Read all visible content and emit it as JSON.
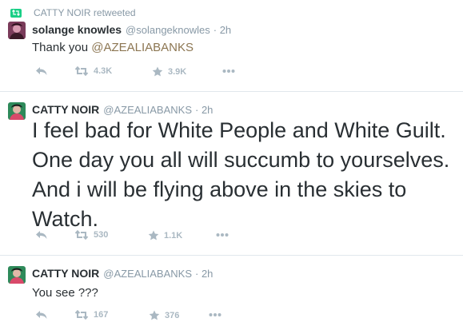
{
  "tweets": [
    {
      "retweeted_by": "CATTY NOIR retweeted",
      "name": "solange knowles",
      "handle": "@solangeknowles",
      "time": "· 2h",
      "text_prefix": "Thank you ",
      "mention": "@AZEALIABANKS",
      "retweets": "4.3K",
      "favorites": "3.9K"
    },
    {
      "name": "CATTY NOIR",
      "handle": "@AZEALIABANKS",
      "time": "· 2h",
      "lines": [
        "I feel bad for White People and White Guilt.",
        "One day you all will succumb to yourselves.",
        "And i will be flying above in the skies to",
        "Watch."
      ],
      "retweets": "530",
      "favorites": "1.1K"
    },
    {
      "name": "CATTY NOIR",
      "handle": "@AZEALIABANKS",
      "time": "· 2h",
      "text": "You see ???",
      "retweets": "167",
      "favorites": "376"
    }
  ],
  "colors": {
    "retweet_icon": "#19cf86",
    "mention": "#8c7652",
    "action_gray": "#aab8c2",
    "meta_gray": "#8899a6"
  },
  "icons": [
    "retweet-icon",
    "reply-icon",
    "favorite-icon",
    "more-icon"
  ]
}
